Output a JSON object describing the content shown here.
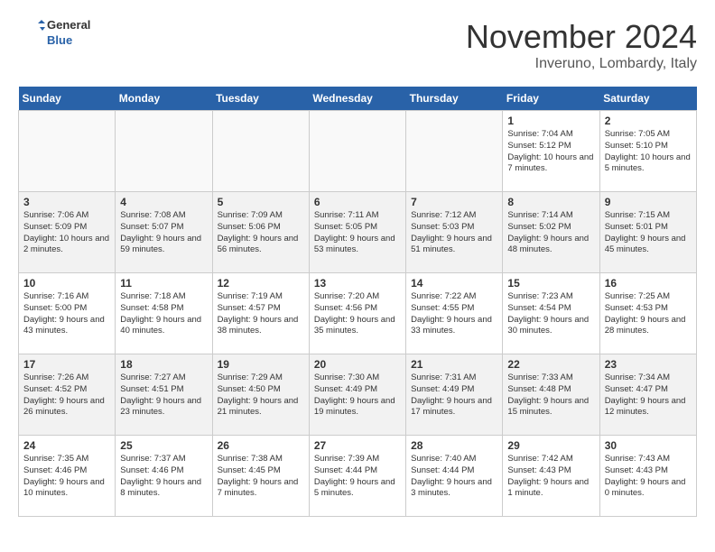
{
  "header": {
    "logo_line1": "General",
    "logo_line2": "Blue",
    "month": "November 2024",
    "location": "Inveruno, Lombardy, Italy"
  },
  "days_of_week": [
    "Sunday",
    "Monday",
    "Tuesday",
    "Wednesday",
    "Thursday",
    "Friday",
    "Saturday"
  ],
  "weeks": [
    [
      {
        "day": "",
        "empty": true
      },
      {
        "day": "",
        "empty": true
      },
      {
        "day": "",
        "empty": true
      },
      {
        "day": "",
        "empty": true
      },
      {
        "day": "",
        "empty": true
      },
      {
        "day": "1",
        "sunrise": "7:04 AM",
        "sunset": "5:12 PM",
        "daylight": "10 hours and 7 minutes."
      },
      {
        "day": "2",
        "sunrise": "7:05 AM",
        "sunset": "5:10 PM",
        "daylight": "10 hours and 5 minutes."
      }
    ],
    [
      {
        "day": "3",
        "sunrise": "7:06 AM",
        "sunset": "5:09 PM",
        "daylight": "10 hours and 2 minutes."
      },
      {
        "day": "4",
        "sunrise": "7:08 AM",
        "sunset": "5:07 PM",
        "daylight": "9 hours and 59 minutes."
      },
      {
        "day": "5",
        "sunrise": "7:09 AM",
        "sunset": "5:06 PM",
        "daylight": "9 hours and 56 minutes."
      },
      {
        "day": "6",
        "sunrise": "7:11 AM",
        "sunset": "5:05 PM",
        "daylight": "9 hours and 53 minutes."
      },
      {
        "day": "7",
        "sunrise": "7:12 AM",
        "sunset": "5:03 PM",
        "daylight": "9 hours and 51 minutes."
      },
      {
        "day": "8",
        "sunrise": "7:14 AM",
        "sunset": "5:02 PM",
        "daylight": "9 hours and 48 minutes."
      },
      {
        "day": "9",
        "sunrise": "7:15 AM",
        "sunset": "5:01 PM",
        "daylight": "9 hours and 45 minutes."
      }
    ],
    [
      {
        "day": "10",
        "sunrise": "7:16 AM",
        "sunset": "5:00 PM",
        "daylight": "9 hours and 43 minutes."
      },
      {
        "day": "11",
        "sunrise": "7:18 AM",
        "sunset": "4:58 PM",
        "daylight": "9 hours and 40 minutes."
      },
      {
        "day": "12",
        "sunrise": "7:19 AM",
        "sunset": "4:57 PM",
        "daylight": "9 hours and 38 minutes."
      },
      {
        "day": "13",
        "sunrise": "7:20 AM",
        "sunset": "4:56 PM",
        "daylight": "9 hours and 35 minutes."
      },
      {
        "day": "14",
        "sunrise": "7:22 AM",
        "sunset": "4:55 PM",
        "daylight": "9 hours and 33 minutes."
      },
      {
        "day": "15",
        "sunrise": "7:23 AM",
        "sunset": "4:54 PM",
        "daylight": "9 hours and 30 minutes."
      },
      {
        "day": "16",
        "sunrise": "7:25 AM",
        "sunset": "4:53 PM",
        "daylight": "9 hours and 28 minutes."
      }
    ],
    [
      {
        "day": "17",
        "sunrise": "7:26 AM",
        "sunset": "4:52 PM",
        "daylight": "9 hours and 26 minutes."
      },
      {
        "day": "18",
        "sunrise": "7:27 AM",
        "sunset": "4:51 PM",
        "daylight": "9 hours and 23 minutes."
      },
      {
        "day": "19",
        "sunrise": "7:29 AM",
        "sunset": "4:50 PM",
        "daylight": "9 hours and 21 minutes."
      },
      {
        "day": "20",
        "sunrise": "7:30 AM",
        "sunset": "4:49 PM",
        "daylight": "9 hours and 19 minutes."
      },
      {
        "day": "21",
        "sunrise": "7:31 AM",
        "sunset": "4:49 PM",
        "daylight": "9 hours and 17 minutes."
      },
      {
        "day": "22",
        "sunrise": "7:33 AM",
        "sunset": "4:48 PM",
        "daylight": "9 hours and 15 minutes."
      },
      {
        "day": "23",
        "sunrise": "7:34 AM",
        "sunset": "4:47 PM",
        "daylight": "9 hours and 12 minutes."
      }
    ],
    [
      {
        "day": "24",
        "sunrise": "7:35 AM",
        "sunset": "4:46 PM",
        "daylight": "9 hours and 10 minutes."
      },
      {
        "day": "25",
        "sunrise": "7:37 AM",
        "sunset": "4:46 PM",
        "daylight": "9 hours and 8 minutes."
      },
      {
        "day": "26",
        "sunrise": "7:38 AM",
        "sunset": "4:45 PM",
        "daylight": "9 hours and 7 minutes."
      },
      {
        "day": "27",
        "sunrise": "7:39 AM",
        "sunset": "4:44 PM",
        "daylight": "9 hours and 5 minutes."
      },
      {
        "day": "28",
        "sunrise": "7:40 AM",
        "sunset": "4:44 PM",
        "daylight": "9 hours and 3 minutes."
      },
      {
        "day": "29",
        "sunrise": "7:42 AM",
        "sunset": "4:43 PM",
        "daylight": "9 hours and 1 minute."
      },
      {
        "day": "30",
        "sunrise": "7:43 AM",
        "sunset": "4:43 PM",
        "daylight": "9 hours and 0 minutes."
      }
    ]
  ]
}
